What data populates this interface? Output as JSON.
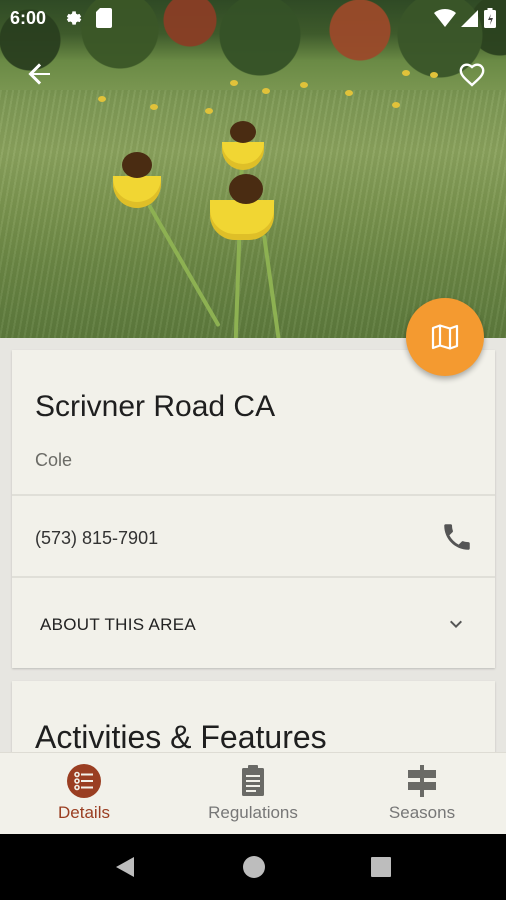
{
  "status_bar": {
    "time": "6:00",
    "icons": [
      "settings-icon",
      "sd-card-icon",
      "wifi-icon",
      "signal-icon",
      "battery-icon"
    ]
  },
  "app_bar": {
    "back_icon": "arrow-back-icon",
    "favorite_icon": "heart-outline-icon"
  },
  "fab": {
    "icon": "map-icon",
    "color": "#f49a30"
  },
  "area": {
    "name": "Scrivner Road CA",
    "county": "Cole",
    "phone": "(573) 815-7901",
    "about_label": "ABOUT THIS AREA"
  },
  "activities": {
    "title": "Activities & Features"
  },
  "bottom_nav": {
    "items": [
      {
        "label": "Details",
        "icon": "details-list-icon",
        "active": true
      },
      {
        "label": "Regulations",
        "icon": "clipboard-icon",
        "active": false
      },
      {
        "label": "Seasons",
        "icon": "signpost-icon",
        "active": false
      }
    ],
    "active_color": "#9a3e22"
  },
  "system_nav": {
    "icons": [
      "back-triangle-icon",
      "home-circle-icon",
      "recents-square-icon"
    ]
  }
}
